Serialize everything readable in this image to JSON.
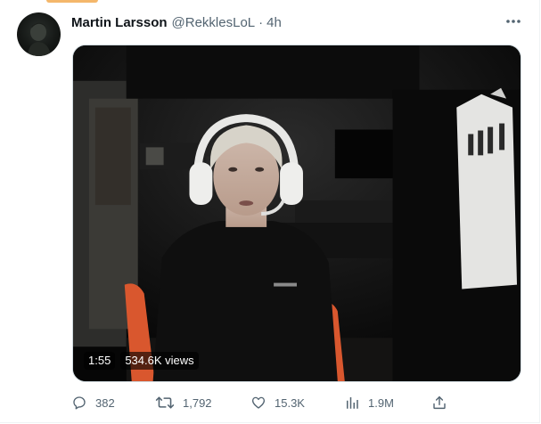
{
  "tweet": {
    "author_name": "Martin Larsson",
    "author_handle": "@RekklesLoL",
    "separator": "·",
    "time": "4h",
    "avatar_icon": "profile-avatar"
  },
  "video": {
    "duration": "1:55",
    "views": "534.6K views"
  },
  "actions": {
    "replies": "382",
    "retweets": "1,792",
    "likes": "15.3K",
    "views": "1.9M"
  },
  "colors": {
    "text_primary": "#0f1419",
    "text_secondary": "#536471",
    "border": "#cfd9de"
  }
}
